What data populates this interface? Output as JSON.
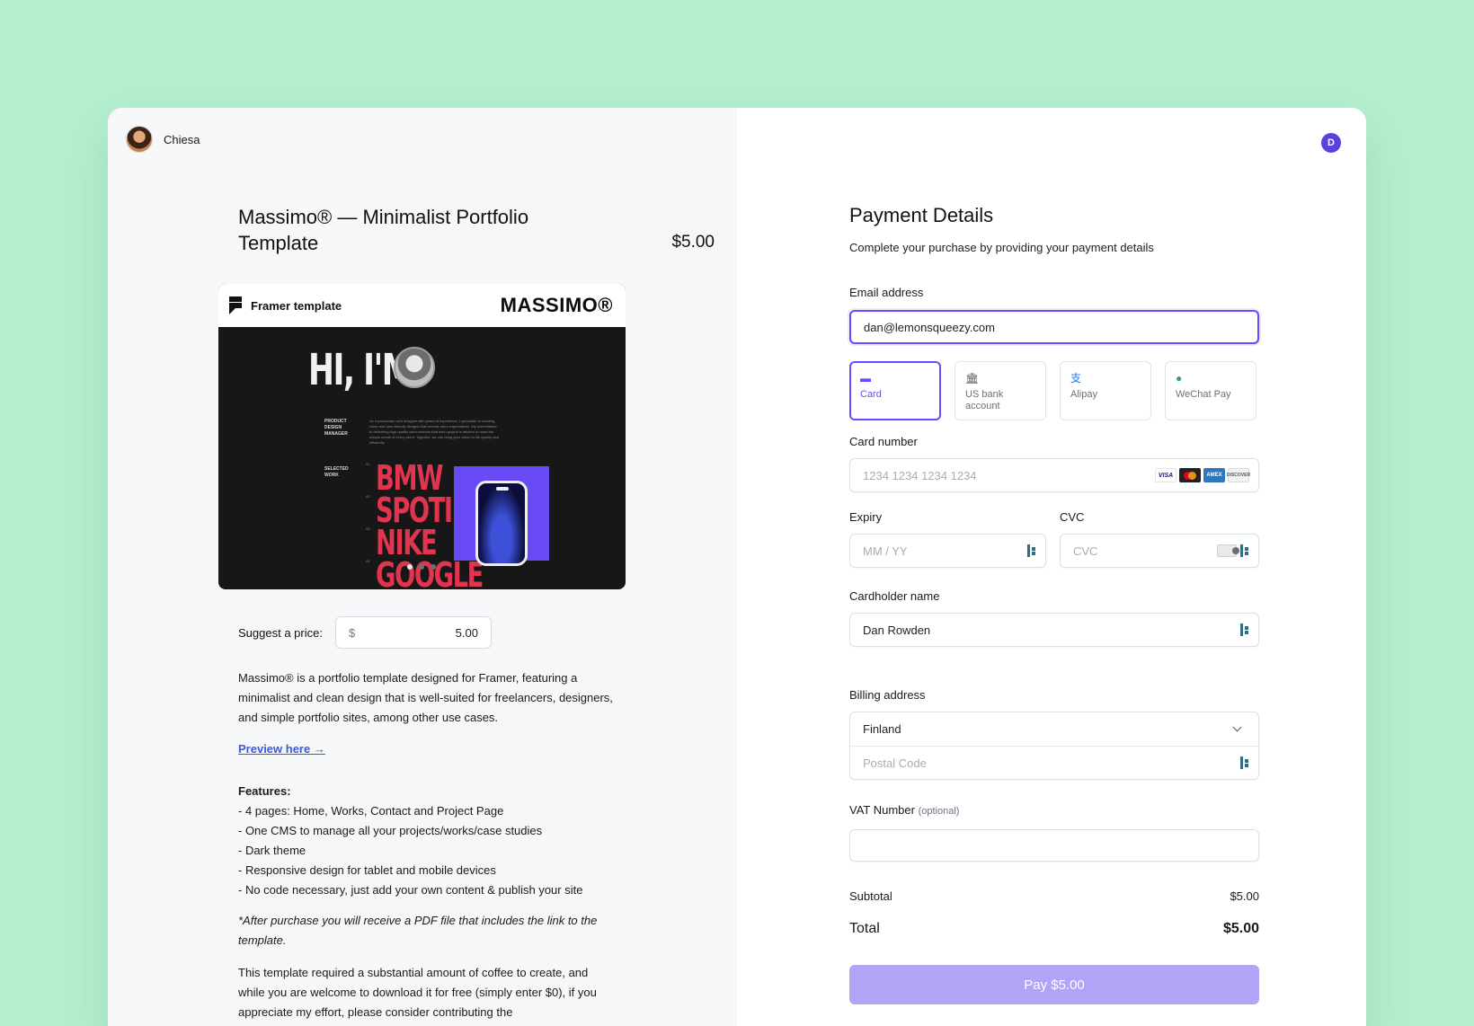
{
  "seller": {
    "name": "Chiesa"
  },
  "product": {
    "title": "Massimo® — Minimalist Portfolio Template",
    "price": "$5.00",
    "preview": {
      "badge": "Framer template",
      "logo": "MASSIMO®",
      "headline": "HI, I'M",
      "role_label": "PRODUCT DESIGN MANAGER",
      "bio": "As a passionate web designer with years of experience, I specialize in creating clean and user-friendly designs that exceed client expectations. My commitment to delivering high-quality work ensures that each project is tailored to meet the unique needs of every client. Together, we can bring your vision to life quickly and efficiently.",
      "selected_label": "SELECTED WORK",
      "works": [
        "BMW",
        "SPOTIFY",
        "NIKE",
        "GOOGLE"
      ],
      "work_nums": [
        "01",
        "02",
        "03",
        "04"
      ]
    },
    "suggest": {
      "label": "Suggest a price:",
      "currency": "$",
      "value": "5.00"
    },
    "description": "Massimo® is a portfolio template designed for Framer, featuring a minimalist and clean design that is well-suited for freelancers, designers, and simple portfolio sites, among other use cases.",
    "preview_link": "Preview here →",
    "features_title": "Features:",
    "features": [
      "- 4 pages: Home, Works, Contact and Project Page",
      "- One CMS to manage all your projects/works/case studies",
      "- Dark theme",
      "- Responsive design for tablet and mobile devices",
      "- No code necessary, just add your own content & publish your site"
    ],
    "note": "*After purchase you will receive a PDF file that includes the link to the template.",
    "coffee": "This template required a substantial amount of coffee to create, and while you are welcome to download it for free (simply enter $0), if you appreciate my effort, please consider contributing the"
  },
  "payment": {
    "user_initial": "D",
    "title": "Payment Details",
    "subtitle": "Complete your purchase by providing your payment details",
    "email": {
      "label": "Email address",
      "value": "dan@lemonsqueezy.com"
    },
    "methods": [
      {
        "label": "Card",
        "icon": "card-icon",
        "glyph": "▬"
      },
      {
        "label": "US bank account",
        "icon": "bank-icon",
        "glyph": "🏛"
      },
      {
        "label": "Alipay",
        "icon": "alipay-icon",
        "glyph": "支"
      },
      {
        "label": "WeChat Pay",
        "icon": "wechat-icon",
        "glyph": "●"
      }
    ],
    "card_number": {
      "label": "Card number",
      "placeholder": "1234 1234 1234 1234",
      "brands": [
        "VISA",
        "",
        "AMEX",
        "DISCOVER"
      ]
    },
    "expiry": {
      "label": "Expiry",
      "placeholder": "MM / YY"
    },
    "cvc": {
      "label": "CVC",
      "placeholder": "CVC"
    },
    "cardholder": {
      "label": "Cardholder name",
      "value": "Dan Rowden"
    },
    "billing": {
      "label": "Billing address",
      "country": "Finland",
      "postal_placeholder": "Postal Code"
    },
    "vat": {
      "label": "VAT Number",
      "optional": "(optional)",
      "value": ""
    },
    "subtotal": {
      "label": "Subtotal",
      "value": "$5.00"
    },
    "total": {
      "label": "Total",
      "value": "$5.00"
    },
    "pay_button": "Pay $5.00"
  },
  "colors": {
    "accent": "#6c47ff",
    "page_bg": "#b4efcf",
    "pay_button": "#b1a4f6",
    "link": "#3b5bdb",
    "brand_red": "#e0344f"
  }
}
